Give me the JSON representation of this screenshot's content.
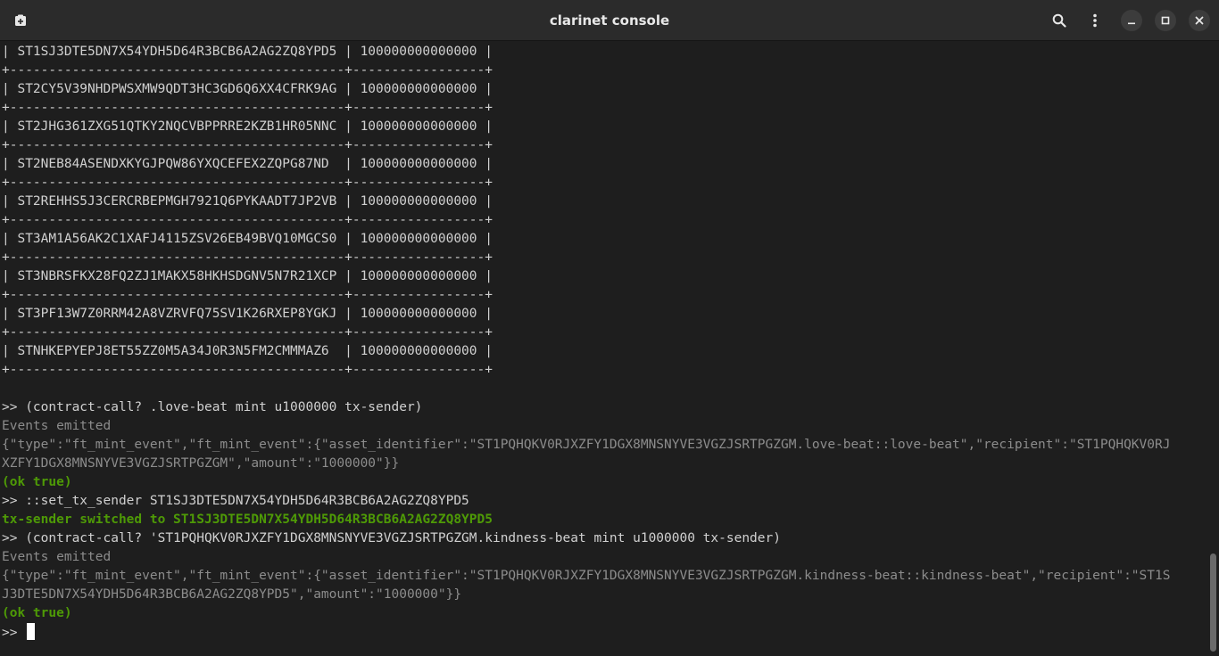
{
  "window": {
    "title": "clarinet console"
  },
  "icons": {
    "new_tab": "new-tab-icon",
    "search": "search-icon",
    "menu": "kebab-menu-icon",
    "minimize": "minimize-icon",
    "maximize": "maximize-icon",
    "close": "close-icon"
  },
  "colors": {
    "background": "#1e1e1e",
    "titlebar": "#2b2b2b",
    "text": "#d0d0d0",
    "dim": "#8c8c8c",
    "success": "#4e9a06"
  },
  "terminal": {
    "lines": [
      {
        "text": "| ST1SJ3DTE5DN7X54YDH5D64R3BCB6A2AG2ZQ8YPD5 | 100000000000000 |",
        "style": "normal"
      },
      {
        "text": "+-------------------------------------------+-----------------+",
        "style": "normal"
      },
      {
        "text": "| ST2CY5V39NHDPWSXMW9QDT3HC3GD6Q6XX4CFRK9AG | 100000000000000 |",
        "style": "normal"
      },
      {
        "text": "+-------------------------------------------+-----------------+",
        "style": "normal"
      },
      {
        "text": "| ST2JHG361ZXG51QTKY2NQCVBPPRRE2KZB1HR05NNC | 100000000000000 |",
        "style": "normal"
      },
      {
        "text": "+-------------------------------------------+-----------------+",
        "style": "normal"
      },
      {
        "text": "| ST2NEB84ASENDXKYGJPQW86YXQCEFEX2ZQPG87ND  | 100000000000000 |",
        "style": "normal"
      },
      {
        "text": "+-------------------------------------------+-----------------+",
        "style": "normal"
      },
      {
        "text": "| ST2REHHS5J3CERCRBEPMGH7921Q6PYKAADT7JP2VB | 100000000000000 |",
        "style": "normal"
      },
      {
        "text": "+-------------------------------------------+-----------------+",
        "style": "normal"
      },
      {
        "text": "| ST3AM1A56AK2C1XAFJ4115ZSV26EB49BVQ10MGCS0 | 100000000000000 |",
        "style": "normal"
      },
      {
        "text": "+-------------------------------------------+-----------------+",
        "style": "normal"
      },
      {
        "text": "| ST3NBRSFKX28FQ2ZJ1MAKX58HKHSDGNV5N7R21XCP | 100000000000000 |",
        "style": "normal"
      },
      {
        "text": "+-------------------------------------------+-----------------+",
        "style": "normal"
      },
      {
        "text": "| ST3PF13W7Z0RRM42A8VZRVFQ75SV1K26RXEP8YGKJ | 100000000000000 |",
        "style": "normal"
      },
      {
        "text": "+-------------------------------------------+-----------------+",
        "style": "normal"
      },
      {
        "text": "| STNHKEPYEPJ8ET55ZZ0M5A34J0R3N5FM2CMMMAZ6  | 100000000000000 |",
        "style": "normal"
      },
      {
        "text": "+-------------------------------------------+-----------------+",
        "style": "normal"
      },
      {
        "text": "",
        "style": "normal"
      },
      {
        "text": ">> (contract-call? .love-beat mint u1000000 tx-sender)",
        "style": "normal"
      },
      {
        "text": "Events emitted",
        "style": "dim"
      },
      {
        "text": "{\"type\":\"ft_mint_event\",\"ft_mint_event\":{\"asset_identifier\":\"ST1PQHQKV0RJXZFY1DGX8MNSNYVE3VGZJSRTPGZGM.love-beat::love-beat\",\"recipient\":\"ST1PQHQKV0RJ",
        "style": "dim"
      },
      {
        "text": "XZFY1DGX8MNSNYVE3VGZJSRTPGZGM\",\"amount\":\"1000000\"}}",
        "style": "dim"
      },
      {
        "text": "(ok true)",
        "style": "green"
      },
      {
        "text": ">> ::set_tx_sender ST1SJ3DTE5DN7X54YDH5D64R3BCB6A2AG2ZQ8YPD5",
        "style": "normal"
      },
      {
        "text": "tx-sender switched to ST1SJ3DTE5DN7X54YDH5D64R3BCB6A2AG2ZQ8YPD5",
        "style": "green"
      },
      {
        "text": ">> (contract-call? 'ST1PQHQKV0RJXZFY1DGX8MNSNYVE3VGZJSRTPGZGM.kindness-beat mint u1000000 tx-sender)",
        "style": "normal"
      },
      {
        "text": "Events emitted",
        "style": "dim"
      },
      {
        "text": "{\"type\":\"ft_mint_event\",\"ft_mint_event\":{\"asset_identifier\":\"ST1PQHQKV0RJXZFY1DGX8MNSNYVE3VGZJSRTPGZGM.kindness-beat::kindness-beat\",\"recipient\":\"ST1S",
        "style": "dim"
      },
      {
        "text": "J3DTE5DN7X54YDH5D64R3BCB6A2AG2ZQ8YPD5\",\"amount\":\"1000000\"}}",
        "style": "dim"
      },
      {
        "text": "(ok true)",
        "style": "green"
      }
    ],
    "prompt": ">> "
  }
}
